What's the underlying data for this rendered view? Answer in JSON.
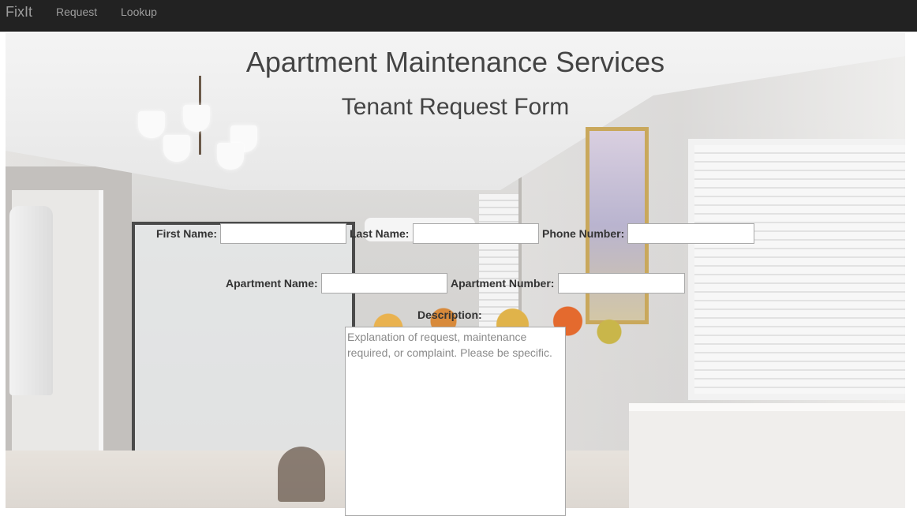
{
  "navbar": {
    "brand": "FixIt",
    "links": [
      {
        "label": "Request"
      },
      {
        "label": "Lookup"
      }
    ],
    "background_color": "#222222",
    "link_color": "#9d9d9d"
  },
  "page": {
    "title": "Apartment Maintenance Services",
    "subtitle": "Tenant Request Form"
  },
  "form": {
    "first_name": {
      "label": "First Name:",
      "value": ""
    },
    "last_name": {
      "label": "Last Name:",
      "value": ""
    },
    "phone_number": {
      "label": "Phone Number:",
      "value": ""
    },
    "apartment_name": {
      "label": "Apartment Name:",
      "value": ""
    },
    "apartment_number": {
      "label": "Apartment Number:",
      "value": ""
    },
    "description": {
      "label": "Description:",
      "value": "",
      "placeholder": "Explanation of request, maintenance required, or complaint. Please be specific."
    }
  }
}
